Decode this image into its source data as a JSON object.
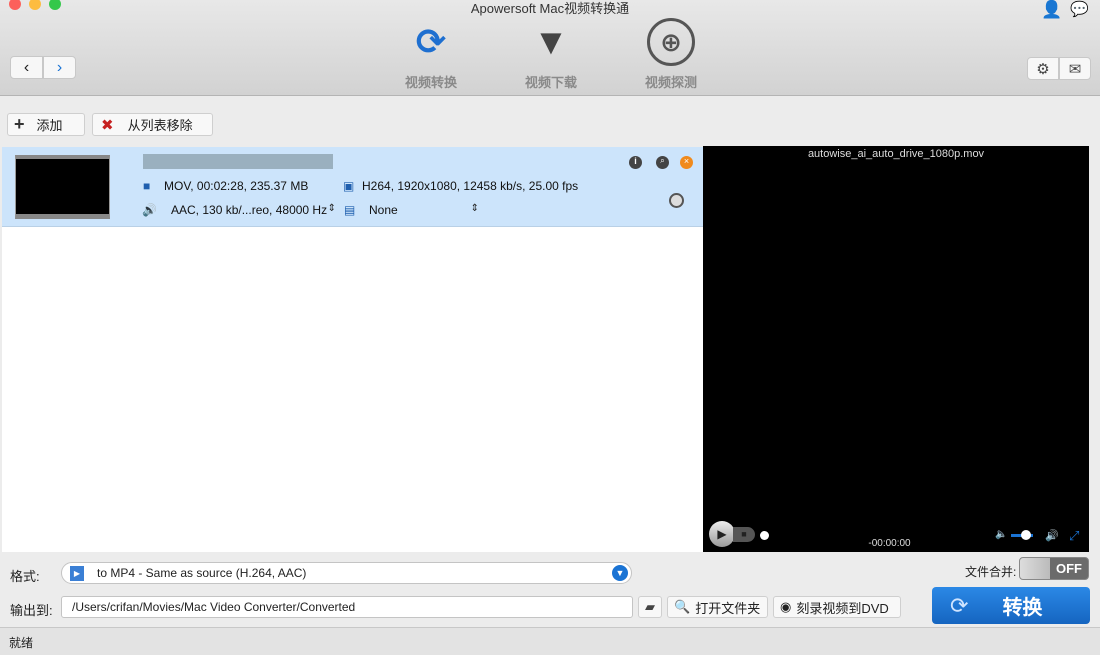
{
  "window": {
    "title": "Apowersoft Mac视频转换通"
  },
  "toolbar": {
    "tabs": [
      {
        "label": "视频转换",
        "icon": "convert-arrows-icon"
      },
      {
        "label": "视频下载",
        "icon": "film-download-icon"
      },
      {
        "label": "视频探测",
        "icon": "radar-icon"
      }
    ]
  },
  "actions": {
    "add": "添加",
    "remove": "从列表移除"
  },
  "file": {
    "meta": "MOV, 00:02:28, 235.37 MB",
    "video": "H264, 1920x1080, 12458 kb/s, 25.00 fps",
    "audio": "AAC, 130 kb/...reo, 48000 Hz",
    "subtitle": "None"
  },
  "preview": {
    "filename": "autowise_ai_auto_drive_1080p.mov",
    "time": "-00:00:00",
    "volume_percent": 60
  },
  "merge": {
    "label": "文件合并:",
    "state": "OFF"
  },
  "format": {
    "label": "格式:",
    "value": "to MP4 - Same as source (H.264, AAC)"
  },
  "output": {
    "label": "输出到:",
    "path": "/Users/crifan/Movies/Mac Video Converter/Converted",
    "open_folder": "打开文件夹",
    "burn_dvd": "刻录视频到DVD"
  },
  "convert": {
    "label": "转换"
  },
  "status": {
    "text": "就绪"
  },
  "colors": {
    "accent": "#1a73d4",
    "selection": "#cce4fb",
    "close_orange": "#f08a1c"
  }
}
